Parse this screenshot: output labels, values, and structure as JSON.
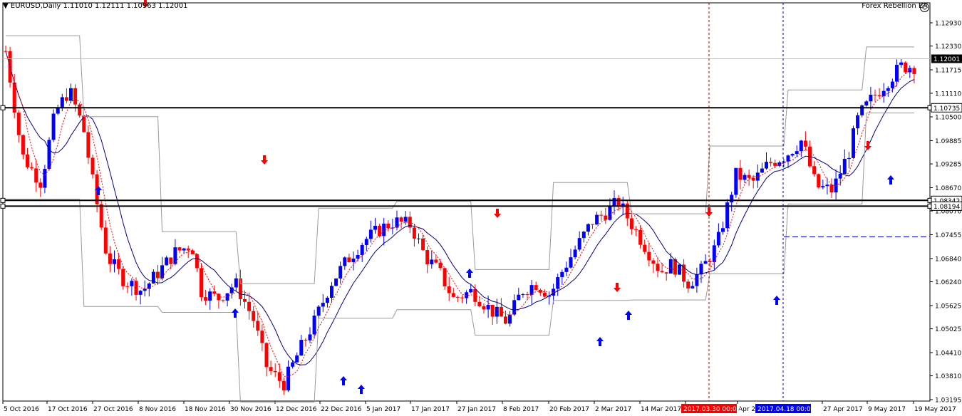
{
  "header": {
    "arrow": "▼",
    "symbol": "EURUSD,Daily",
    "ohlc": "1.11010 1.12111 1.10963 1.12001"
  },
  "ea": {
    "name": "Forex Rebellion EA",
    "icon": "smiley-icon"
  },
  "colors": {
    "bull": "#0000ff",
    "bear": "#ff0000",
    "level_line": "#000000",
    "channel": "#9a9a9a",
    "band": "#00008b",
    "signal": "#ff0000",
    "marker_bg_red": "#ff0000",
    "marker_bg_blue": "#0000ff"
  },
  "price_axis": {
    "labels": [
      "1.12930",
      "1.12330",
      "1.11715",
      "1.11110",
      "1.10500",
      "1.09885",
      "1.09285",
      "1.08670",
      "1.08070",
      "1.07455",
      "1.06840",
      "1.06240",
      "1.05625",
      "1.05025",
      "1.04410",
      "1.03810",
      "1.03195"
    ],
    "current_price": "1.12001",
    "levels": [
      "1.10735",
      "1.08342",
      "1.08194"
    ]
  },
  "time_axis": {
    "labels": [
      "5 Oct 2016",
      "17 Oct 2016",
      "27 Oct 2016",
      "8 Nov 2016",
      "18 Nov 2016",
      "30 Nov 2016",
      "12 Dec 2016",
      "22 Dec 2016",
      "5 Jan 2017",
      "17 Jan 2017",
      "27 Jan 2017",
      "8 Feb 2017",
      "20 Feb 2017",
      "2 Mar 2017",
      "14 Mar 2017",
      "Apr 2",
      "Apr 2017",
      "27 Apr 2017",
      "9 May 2017",
      "19 May 2017"
    ],
    "markers": [
      "2017.03.30 00:00",
      "2017.04.18 00:00"
    ]
  },
  "pending_order_level": "1.07400"
}
